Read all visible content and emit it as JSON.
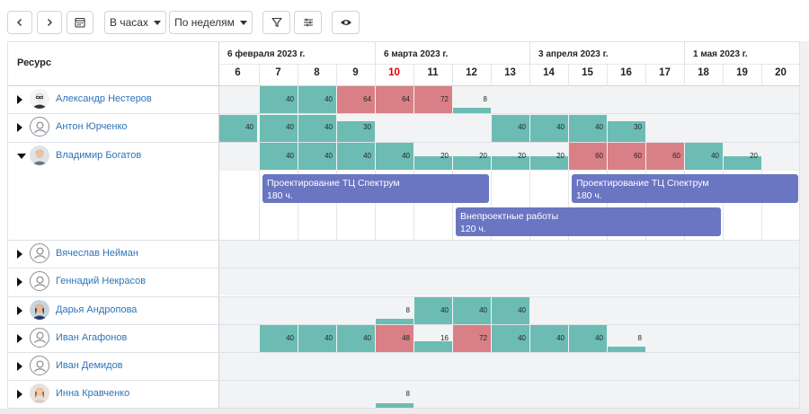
{
  "toolbar": {
    "prev_icon": "chevron-left-icon",
    "next_icon": "chevron-right-icon",
    "calendar_icon": "calendar-icon",
    "units_select": "В часах",
    "period_select": "По неделям",
    "filter_icon": "filter-icon",
    "settings_icon": "sliders-icon",
    "view_icon": "eye-icon"
  },
  "header": {
    "resource_title": "Ресурс",
    "months": [
      "6 февраля 2023 г.",
      "6 марта 2023 г.",
      "3 апреля 2023 г.",
      "1 мая 2023 г."
    ],
    "weeks": [
      "6",
      "7",
      "8",
      "9",
      "10",
      "11",
      "12",
      "13",
      "14",
      "15",
      "16",
      "17",
      "18",
      "19",
      "20"
    ],
    "current_week": "10"
  },
  "colors": {
    "ok": "#6dbcb4",
    "over": "#d98086",
    "task": "#6a76c2",
    "link": "#2f74b7",
    "today": "#e00000"
  },
  "resources": [
    {
      "name": "Александр Нестеров",
      "expanded": false,
      "avatar": "photo-man-glasses",
      "cells": [
        null,
        {
          "v": "40",
          "k": "ok"
        },
        {
          "v": "40",
          "k": "ok"
        },
        {
          "v": "64",
          "k": "over"
        },
        {
          "v": "64",
          "k": "over"
        },
        {
          "v": "72",
          "k": "over"
        },
        {
          "v": "8",
          "k": "ok"
        },
        null,
        null,
        null,
        null,
        null,
        null,
        null,
        null
      ]
    },
    {
      "name": "Антон Юрченко",
      "expanded": false,
      "avatar": "placeholder",
      "cells": [
        {
          "v": "40",
          "k": "ok"
        },
        {
          "v": "40",
          "k": "ok"
        },
        {
          "v": "40",
          "k": "ok"
        },
        {
          "v": "30",
          "k": "ok"
        },
        null,
        null,
        null,
        {
          "v": "40",
          "k": "ok"
        },
        {
          "v": "40",
          "k": "ok"
        },
        {
          "v": "40",
          "k": "ok"
        },
        {
          "v": "30",
          "k": "ok"
        },
        null,
        null,
        null,
        null
      ]
    },
    {
      "name": "Владимир Богатов",
      "expanded": true,
      "avatar": "photo-man",
      "cells": [
        null,
        {
          "v": "40",
          "k": "ok"
        },
        {
          "v": "40",
          "k": "ok"
        },
        {
          "v": "40",
          "k": "ok"
        },
        {
          "v": "40",
          "k": "ok"
        },
        {
          "v": "20",
          "k": "ok"
        },
        {
          "v": "20",
          "k": "ok"
        },
        {
          "v": "20",
          "k": "ok"
        },
        {
          "v": "20",
          "k": "ok"
        },
        {
          "v": "60",
          "k": "over"
        },
        {
          "v": "60",
          "k": "over"
        },
        {
          "v": "60",
          "k": "over"
        },
        {
          "v": "40",
          "k": "ok"
        },
        {
          "v": "20",
          "k": "ok"
        },
        null
      ],
      "tasks": [
        {
          "title": "Проектирование ТЦ Спектрум",
          "hours": "180 ч.",
          "start": 1,
          "end": 6,
          "lane": 0
        },
        {
          "title": "Проектирование ТЦ Спектрум",
          "hours": "180 ч.",
          "start": 9,
          "end": 14,
          "lane": 0
        },
        {
          "title": "Внепроектные работы",
          "hours": "120 ч.",
          "start": 6,
          "end": 12,
          "lane": 1
        }
      ]
    },
    {
      "name": "Вячеслав Нейман",
      "expanded": false,
      "avatar": "placeholder",
      "cells": []
    },
    {
      "name": "Геннадий Некрасов",
      "expanded": false,
      "avatar": "placeholder",
      "cells": []
    },
    {
      "name": "Дарья Андропова",
      "expanded": false,
      "avatar": "photo-woman",
      "cells": [
        null,
        null,
        null,
        null,
        {
          "v": "8",
          "k": "ok"
        },
        {
          "v": "40",
          "k": "ok"
        },
        {
          "v": "40",
          "k": "ok"
        },
        {
          "v": "40",
          "k": "ok"
        },
        null,
        null,
        null,
        null,
        null,
        null,
        null
      ]
    },
    {
      "name": "Иван Агафонов",
      "expanded": false,
      "avatar": "placeholder",
      "cells": [
        null,
        {
          "v": "40",
          "k": "ok"
        },
        {
          "v": "40",
          "k": "ok"
        },
        {
          "v": "40",
          "k": "ok"
        },
        {
          "v": "48",
          "k": "over"
        },
        {
          "v": "16",
          "k": "ok"
        },
        {
          "v": "72",
          "k": "over"
        },
        {
          "v": "40",
          "k": "ok"
        },
        {
          "v": "40",
          "k": "ok"
        },
        {
          "v": "40",
          "k": "ok"
        },
        {
          "v": "8",
          "k": "ok"
        },
        null,
        null,
        null,
        null
      ]
    },
    {
      "name": "Иван Демидов",
      "expanded": false,
      "avatar": "placeholder",
      "cells": []
    },
    {
      "name": "Инна Кравченко",
      "expanded": false,
      "avatar": "photo-woman-2",
      "cells": [
        null,
        null,
        null,
        null,
        {
          "v": "8",
          "k": "ok"
        },
        null,
        null,
        null,
        null,
        null,
        null,
        null,
        null,
        null,
        null
      ]
    }
  ]
}
